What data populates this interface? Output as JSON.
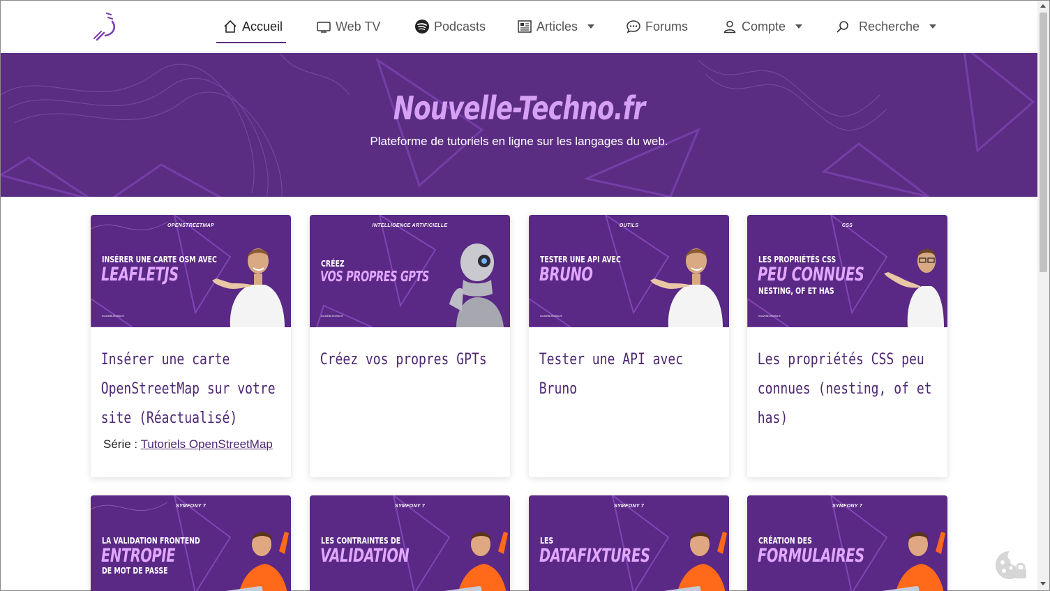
{
  "nav": {
    "items": [
      {
        "label": "Accueil",
        "icon": "home-icon"
      },
      {
        "label": "Web TV",
        "icon": "tv-icon"
      },
      {
        "label": "Podcasts",
        "icon": "spotify-icon"
      },
      {
        "label": "Articles",
        "icon": "newspaper-icon"
      },
      {
        "label": "Forums",
        "icon": "chat-icon"
      },
      {
        "label": "Compte",
        "icon": "user-icon"
      },
      {
        "label": "Recherche",
        "icon": "search-icon"
      }
    ]
  },
  "hero": {
    "title": "Nouvelle-Techno.fr",
    "subtitle": "Plateforme de tutoriels en ligne sur les langages du web."
  },
  "cards": [
    {
      "category": "OPENSTREETMAP",
      "thumb_pre": "INSÉRER UNE CARTE OSM AVEC",
      "thumb_big": "LEAFLETJS",
      "thumb_post": "",
      "site": "nouvelle-techno.fr",
      "title": "Insérer une carte OpenStreetMap sur votre site (Réactualisé)",
      "serie_label": "Série :",
      "serie_link": "Tutoriels OpenStreetMap"
    },
    {
      "category": "INTELLIGENCE ARTIFICIELLE",
      "thumb_pre": "CRÉEZ",
      "thumb_big": "VOS PROPRES GPTS",
      "thumb_post": "",
      "site": "nouvelle-techno.fr",
      "title": "Créez vos propres GPTs"
    },
    {
      "category": "OUTILS",
      "thumb_pre": "TESTER UNE API AVEC",
      "thumb_big": "BRUNO",
      "thumb_post": "",
      "site": "nouvelle-techno.fr",
      "title": "Tester une API avec Bruno"
    },
    {
      "category": "CSS",
      "thumb_pre": "LES PROPRIÉTÉS CSS",
      "thumb_big": "PEU CONNUES",
      "thumb_post": "NESTING, OF ET HAS",
      "site": "nouvelle-techno.fr",
      "title": "Les propriétés CSS peu connues (nesting, of et has)"
    },
    {
      "category": "SYMFONY 7",
      "thumb_pre": "LA VALIDATION FRONTEND",
      "thumb_big": "ENTROPIE",
      "thumb_post": "DE MOT DE PASSE"
    },
    {
      "category": "SYMFONY 7",
      "thumb_pre": "LES CONTRAINTES DE",
      "thumb_big": "VALIDATION",
      "thumb_post": ""
    },
    {
      "category": "SYMFONY 7",
      "thumb_pre": "LES",
      "thumb_big": "DATAFIXTURES",
      "thumb_post": ""
    },
    {
      "category": "SYMFONY 7",
      "thumb_pre": "CRÉATION DES",
      "thumb_big": "FORMULAIRES",
      "thumb_post": ""
    }
  ],
  "colors": {
    "brand_purple": "#5b2d82",
    "title_purple": "#4e2774",
    "hero_title": "#d6a0f5"
  }
}
